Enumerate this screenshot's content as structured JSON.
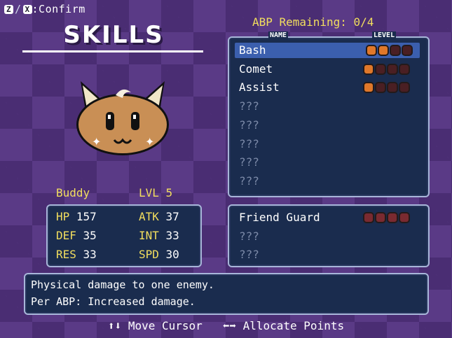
{
  "controls": {
    "key_z": "Z",
    "key_x": "X",
    "separator": "/",
    "label": ":Confirm"
  },
  "title": "SKILLS",
  "abp": {
    "label": "ABP Remaining: 0/4"
  },
  "skills_panel": {
    "col_name": "NAME",
    "col_level": "LEVEL",
    "rows": [
      {
        "name": "Bash",
        "level": 2,
        "max": 4,
        "selected": true
      },
      {
        "name": "Comet",
        "level": 1,
        "max": 4
      },
      {
        "name": "Assist",
        "level": 1,
        "max": 4
      },
      {
        "name": "???"
      },
      {
        "name": "???"
      },
      {
        "name": "???"
      },
      {
        "name": "???"
      },
      {
        "name": "???"
      }
    ]
  },
  "passive_panel": {
    "rows": [
      {
        "name": "Friend Guard",
        "level": 0,
        "max": 4,
        "locked": true
      },
      {
        "name": "???"
      },
      {
        "name": "???"
      }
    ]
  },
  "character": {
    "name": "Buddy",
    "level_label": "LVL 5",
    "portrait_icon": "cat-face-icon"
  },
  "stats": {
    "hp": {
      "label": "HP",
      "value": "157"
    },
    "atk": {
      "label": "ATK",
      "value": "37"
    },
    "def": {
      "label": "DEF",
      "value": "35"
    },
    "int": {
      "label": "INT",
      "value": "33"
    },
    "res": {
      "label": "RES",
      "value": "33"
    },
    "spd": {
      "label": "SPD",
      "value": "30"
    }
  },
  "description": {
    "line1": "Physical damage to one enemy.",
    "line2": "Per ABP: Increased damage."
  },
  "footer": {
    "move_arrows": "⬆⬇",
    "move_label": "Move Cursor",
    "alloc_arrows": "⬅➡",
    "alloc_label": "Allocate Points"
  },
  "colors": {
    "background": "#5a3a86",
    "panel": "#1a2c4e",
    "panel_border": "#a8b6d9",
    "highlight": "#3b5fae",
    "label_yellow": "#f2de5e",
    "pip_on": "#e0782a",
    "pip_off": "#4a1f23"
  }
}
